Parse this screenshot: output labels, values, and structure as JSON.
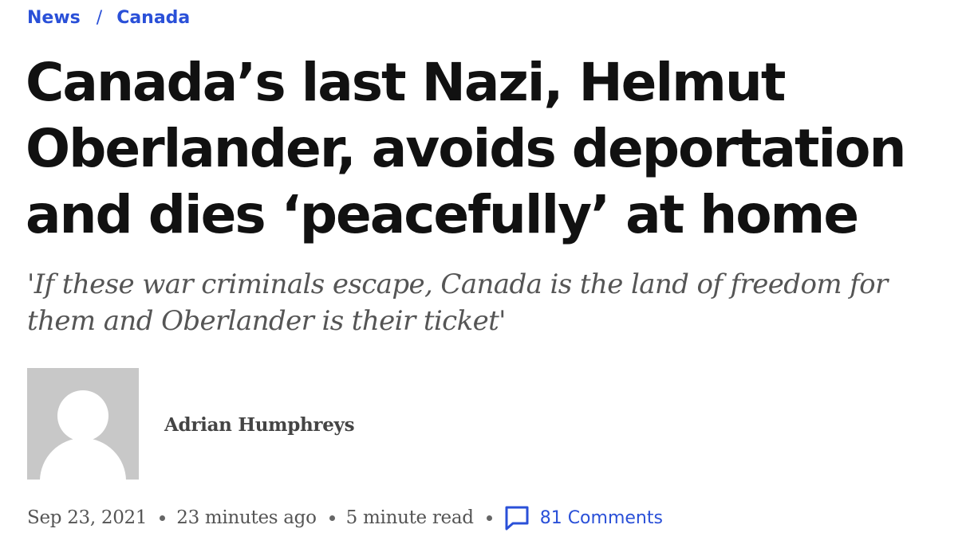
{
  "breadcrumb": {
    "items": [
      {
        "label": "News"
      },
      {
        "label": "Canada"
      }
    ],
    "separator": "/"
  },
  "article": {
    "headline": "Canada’s last Nazi, Helmut Oberlander, avoids deportation and dies ‘peacefully’ at home",
    "subheadline": "'If these war criminals escape, Canada is the land of freedom for them and Oberlander is their ticket'"
  },
  "author": {
    "name": "Adrian Humphreys",
    "avatar_icon": "default-avatar-icon"
  },
  "meta": {
    "date": "Sep 23, 2021",
    "relative_time": "23 minutes ago",
    "read_time": "5 minute read",
    "comments_label": "81 Comments",
    "comments_icon": "comment-bubble-icon"
  },
  "colors": {
    "link": "#2a50d8",
    "headline": "#111111",
    "subhead": "#555555",
    "avatar_bg": "#c8c8c8"
  }
}
